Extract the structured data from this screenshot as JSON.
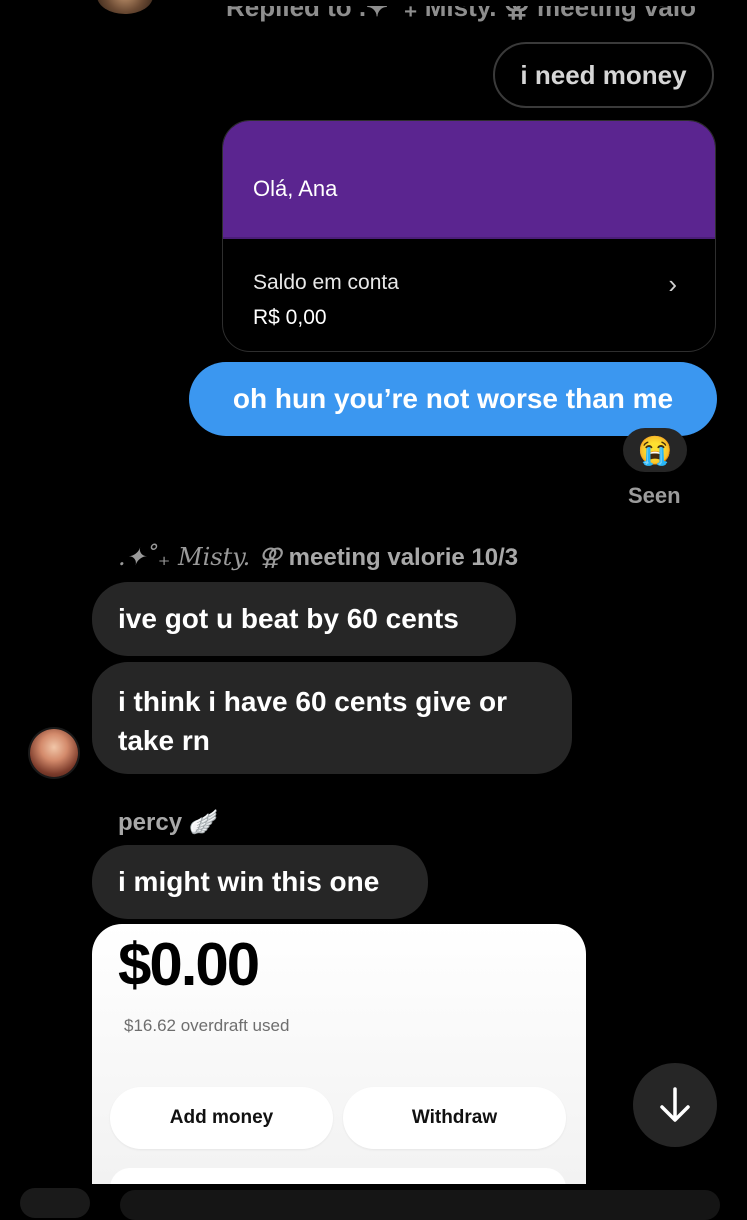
{
  "header": {
    "replied_to_text": "Replied to .✦ ˚₊ Misty. ⚢ meeting valo..."
  },
  "messages": {
    "outgoing_pill": "i need money",
    "bank_card": {
      "greeting": "Olá, Ana",
      "balance_label": "Saldo em conta",
      "balance_value": "R$ 0,00",
      "chevron": "›"
    },
    "outgoing_blue": "oh hun you’re not worse than me",
    "reaction_emoji": "😭",
    "seen_label": "Seen",
    "sender1_deco": ".✦˚₊ Misty. ⚢",
    "sender1_rest": "meeting valorie 10/3",
    "incoming_1": "ive got u beat by 60 cents",
    "incoming_2": "i think i have 60 cents give or take rn",
    "sender2": "percy 🪽",
    "incoming_3": "i might win this one",
    "cash_card": {
      "amount": "$0.00",
      "overdraft": "$16.62 overdraft used",
      "add_label": "Add money",
      "withdraw_label": "Withdraw"
    }
  },
  "icons": {
    "scroll_down": "arrow-down-icon"
  }
}
